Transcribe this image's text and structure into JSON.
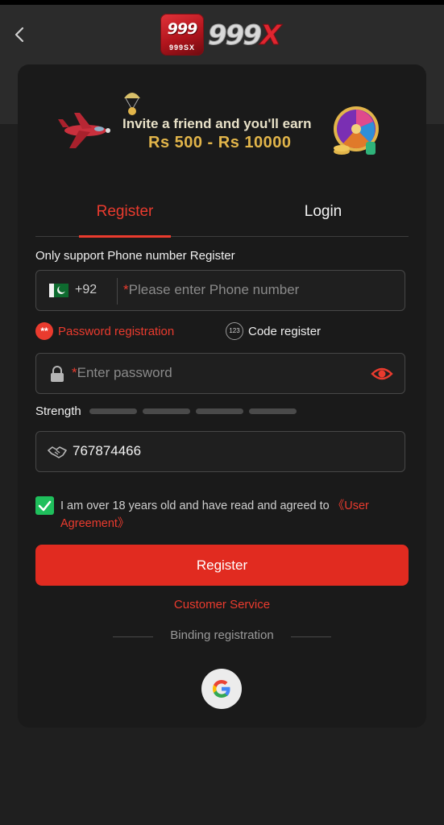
{
  "header": {
    "logo_badge_top": "999",
    "logo_badge_bottom": "999SX",
    "logo_numbers": "999",
    "logo_x": "X"
  },
  "banner": {
    "title": "Invite a friend and you'll earn",
    "amount": "Rs 500 - Rs 10000"
  },
  "tabs": [
    {
      "label": "Register",
      "active": true
    },
    {
      "label": "Login",
      "active": false
    }
  ],
  "form": {
    "support_text": "Only support Phone number Register",
    "phone": {
      "country_code": "+92",
      "required_mark": "*",
      "placeholder": "Please enter Phone number",
      "flag": "pakistan-flag-icon"
    },
    "options": {
      "password_label": "Password registration",
      "password_icon": "**",
      "code_label": "Code register",
      "code_icon": "123"
    },
    "password": {
      "required_mark": "*",
      "placeholder": "Enter password"
    },
    "strength": {
      "label": "Strength",
      "level": 0,
      "max": 4
    },
    "invite_code": {
      "value": "767874466"
    },
    "agreement": {
      "checked": true,
      "text": "I am over 18 years old and have read and agreed to ",
      "link": "《User Agreement》"
    },
    "submit_label": "Register",
    "customer_service": "Customer Service",
    "binding_label": "Binding registration"
  },
  "colors": {
    "accent": "#e12b20",
    "check": "#1fbf5c",
    "gold": "#e2b54a"
  }
}
